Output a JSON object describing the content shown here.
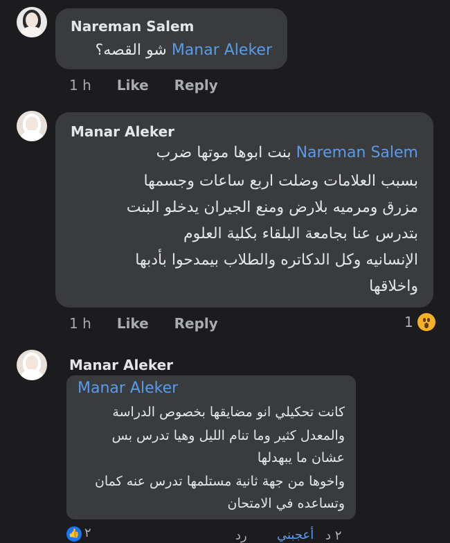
{
  "comments": [
    {
      "author": "Nareman Salem",
      "mention": "Manar Aleker",
      "text_after_mention": "شو القصه؟",
      "time": "1 h",
      "like": "Like",
      "reply": "Reply"
    },
    {
      "author": "Manar Aleker",
      "mention": "Nareman Salem",
      "lines": [
        "بنت ابوها موتها  ضرب",
        "بسبب العلامات وضلت اربع ساعات وجسمها",
        "مزرق ومرميه بلارض ومنع الجيران يدخلو البنت",
        "بتدرس عنا بجامعة البلقاء بكلية العلوم",
        "الإنسانيه وكل الدكاتره والطلاب بيمدحوا بأدبها",
        "واخلاقها"
      ],
      "time": "1 h",
      "like": "Like",
      "reply": "Reply",
      "reaction_count": "1",
      "reaction_icon": "wow-icon"
    },
    {
      "author": "Manar Aleker",
      "shared": {
        "name": "Manar Aleker",
        "lines": [
          "كانت تحكيلي انو مضايقها بخصوص الدراسة",
          "والمعدل كثير وما تنام الليل وهيا تدرس بس",
          "عشان ما يبهدلها",
          "واخوها من جهة ثانية مستلمها تدرس عنه كمان",
          "وتساعده في الامتحان"
        ],
        "footer_count": "٢",
        "footer_like": "أعجبني",
        "footer_time": "٢ د",
        "footer_reply": "رد"
      }
    }
  ],
  "colors": {
    "background": "#1c1c1e",
    "bubble": "#3a3b3c",
    "mention": "#5a9bea",
    "meta": "#a8abaf"
  }
}
